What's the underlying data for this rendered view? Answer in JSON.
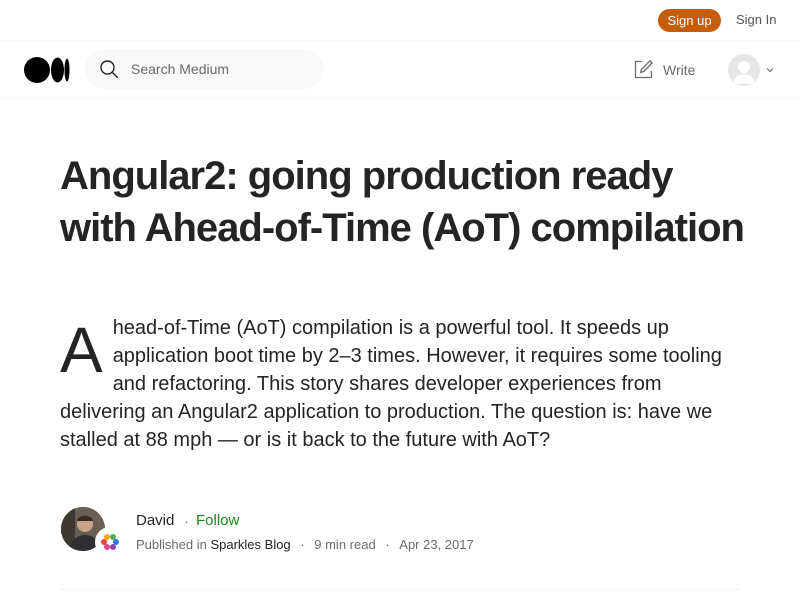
{
  "topbar": {
    "signup_label": "Sign up",
    "signin_label": "Sign In"
  },
  "header": {
    "logo_icon": "medium-logo-icon",
    "search": {
      "placeholder": "Search Medium",
      "value": ""
    },
    "write_label": "Write"
  },
  "article": {
    "title": "Angular2: going production ready with Ahead-of-Time (AoT) compilation",
    "subtitle_dropcap": "A",
    "subtitle_rest": "head-of-Time (AoT) compilation is a powerful tool. It speeds up application boot time by 2–3 times. However, it requires some tooling and refactoring. This story shares developer experiences from delivering an Angular2 application to production. The question is: have we stalled at 88 mph — or is it back to the future with AoT?"
  },
  "author": {
    "name": "David",
    "follow_label": "Follow",
    "published_in_prefix": "Published in",
    "publication": "Sparkles Blog",
    "read_time": "9 min read",
    "date": "Apr 23, 2017"
  },
  "colors": {
    "brand_accent": "#c65d0b",
    "follow_green": "#1a8917",
    "text_primary": "#242424",
    "text_secondary": "#6b6b6b"
  }
}
